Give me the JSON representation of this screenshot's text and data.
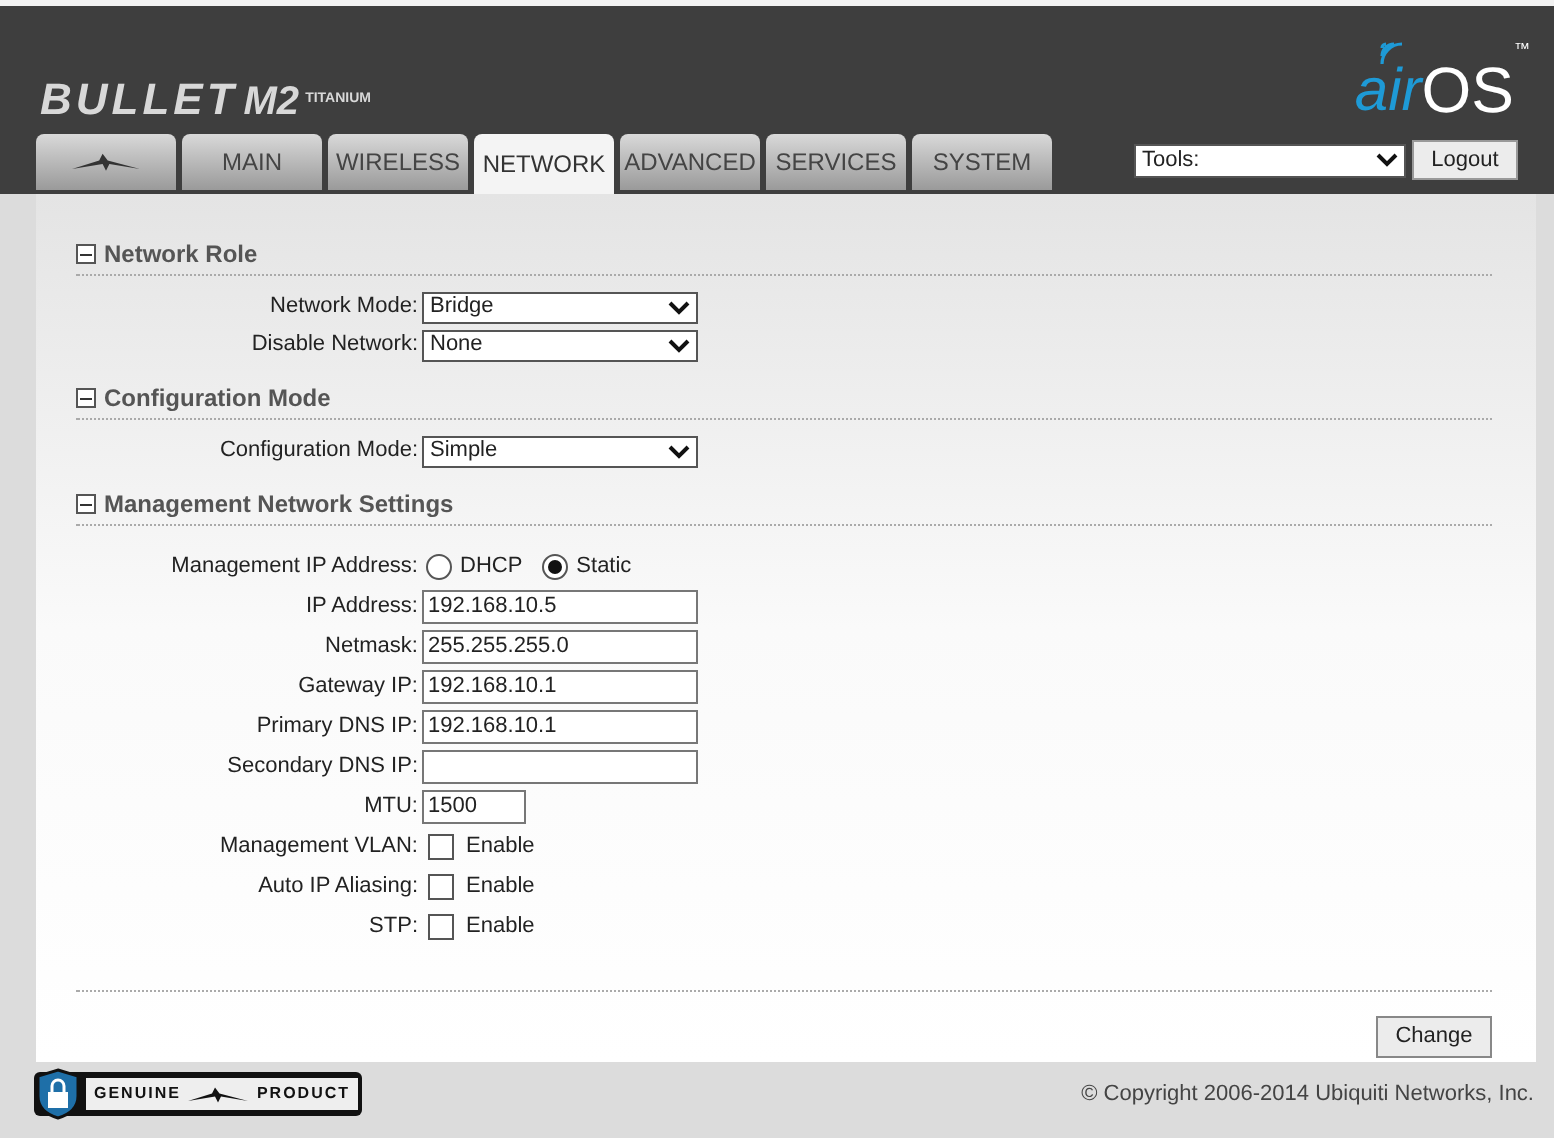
{
  "header": {
    "product": "BULLET",
    "model": "M2",
    "edition": "TITANIUM",
    "brand_prefix": "air",
    "brand_suffix": "OS",
    "trademark": "™"
  },
  "tabs": [
    {
      "kind": "logo",
      "selected": false
    },
    {
      "kind": "text",
      "label": "MAIN",
      "selected": false
    },
    {
      "kind": "text",
      "label": "WIRELESS",
      "selected": false
    },
    {
      "kind": "text",
      "label": "NETWORK",
      "selected": true
    },
    {
      "kind": "text",
      "label": "ADVANCED",
      "selected": false
    },
    {
      "kind": "text",
      "label": "SERVICES",
      "selected": false
    },
    {
      "kind": "text",
      "label": "SYSTEM",
      "selected": false
    }
  ],
  "tools": {
    "value": "Tools:"
  },
  "logout_button": "Logout",
  "sections": [
    {
      "title": "Network Role",
      "expanded": true,
      "fields": [
        {
          "kind": "select",
          "label": "Network Mode:",
          "value": "Bridge"
        },
        {
          "kind": "select",
          "label": "Disable Network:",
          "value": "None"
        }
      ]
    },
    {
      "title": "Configuration Mode",
      "expanded": true,
      "fields": [
        {
          "kind": "select",
          "label": "Configuration Mode:",
          "value": "Simple"
        }
      ]
    },
    {
      "title": "Management Network Settings",
      "expanded": true,
      "fields": [
        {
          "kind": "radio",
          "label": "Management IP Address:",
          "options": [
            {
              "label": "DHCP",
              "selected": false
            },
            {
              "label": "Static",
              "selected": true
            }
          ]
        },
        {
          "kind": "text",
          "label": "IP Address:",
          "value": "192.168.10.5"
        },
        {
          "kind": "text",
          "label": "Netmask:",
          "value": "255.255.255.0"
        },
        {
          "kind": "text",
          "label": "Gateway IP:",
          "value": "192.168.10.1"
        },
        {
          "kind": "text",
          "label": "Primary DNS IP:",
          "value": "192.168.10.1"
        },
        {
          "kind": "text",
          "label": "Secondary DNS IP:"
        },
        {
          "kind": "short",
          "label": "MTU:",
          "value": "1500"
        },
        {
          "kind": "checkbox",
          "label": "Management VLAN:",
          "option": "Enable",
          "checked": false
        },
        {
          "kind": "checkbox",
          "label": "Auto IP Aliasing:",
          "option": "Enable",
          "checked": false
        },
        {
          "kind": "checkbox",
          "label": "STP:",
          "option": "Enable",
          "checked": false
        }
      ]
    }
  ],
  "change_button": "Change",
  "footer": {
    "badge_left": "GENUINE",
    "badge_right": "PRODUCT",
    "copyright": "© Copyright 2006-2014 Ubiquiti Networks, Inc."
  }
}
